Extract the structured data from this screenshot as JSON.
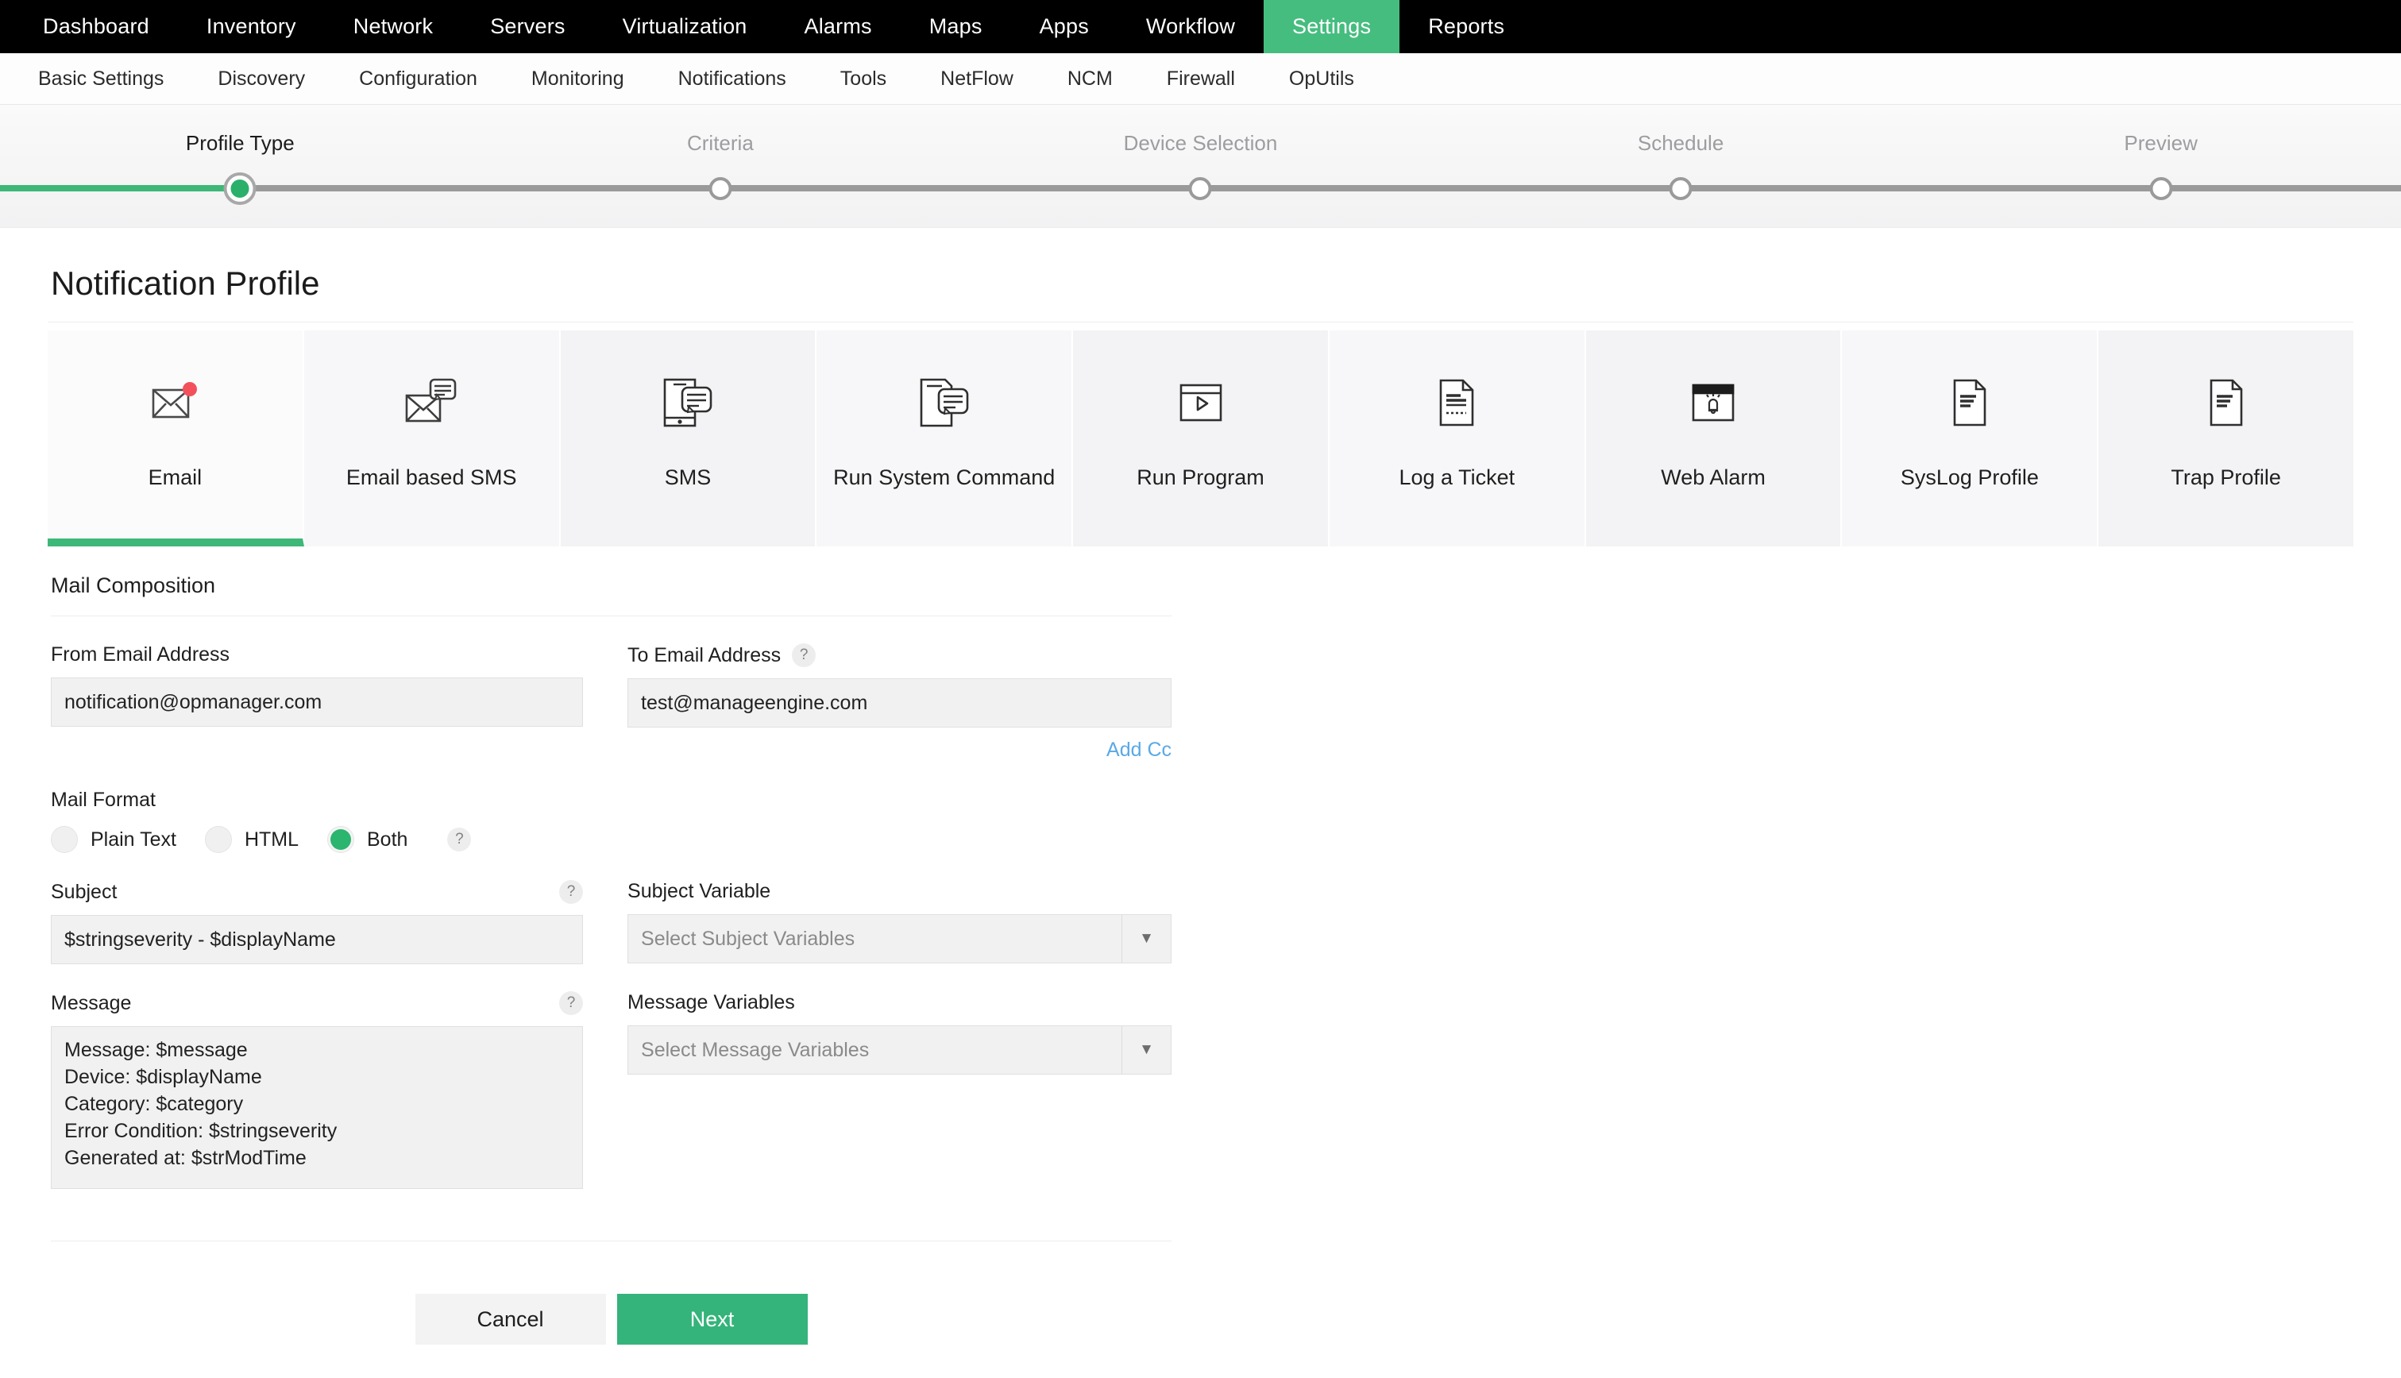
{
  "topnav": {
    "items": [
      {
        "label": "Dashboard",
        "active": false
      },
      {
        "label": "Inventory",
        "active": false
      },
      {
        "label": "Network",
        "active": false
      },
      {
        "label": "Servers",
        "active": false
      },
      {
        "label": "Virtualization",
        "active": false
      },
      {
        "label": "Alarms",
        "active": false
      },
      {
        "label": "Maps",
        "active": false
      },
      {
        "label": "Apps",
        "active": false
      },
      {
        "label": "Workflow",
        "active": false
      },
      {
        "label": "Settings",
        "active": true
      },
      {
        "label": "Reports",
        "active": false
      }
    ],
    "active_color": "#45bd7f"
  },
  "subnav": {
    "items": [
      {
        "label": "Basic Settings"
      },
      {
        "label": "Discovery"
      },
      {
        "label": "Configuration"
      },
      {
        "label": "Monitoring"
      },
      {
        "label": "Notifications"
      },
      {
        "label": "Tools"
      },
      {
        "label": "NetFlow"
      },
      {
        "label": "NCM"
      },
      {
        "label": "Firewall"
      },
      {
        "label": "OpUtils"
      }
    ]
  },
  "wizard": {
    "steps": [
      {
        "label": "Profile Type",
        "state": "active"
      },
      {
        "label": "Criteria",
        "state": "pending"
      },
      {
        "label": "Device Selection",
        "state": "pending"
      },
      {
        "label": "Schedule",
        "state": "pending"
      },
      {
        "label": "Preview",
        "state": "pending"
      }
    ],
    "progress_color": "#3eb878",
    "track_color": "#9a9a9a"
  },
  "page": {
    "title": "Notification Profile"
  },
  "profile_types": [
    {
      "label": "Email",
      "icon": "envelope-alert-icon",
      "selected": true
    },
    {
      "label": "Email based SMS",
      "icon": "envelope-chat-icon",
      "selected": false
    },
    {
      "label": "SMS",
      "icon": "phone-chat-icon",
      "selected": false
    },
    {
      "label": "Run System Command",
      "icon": "document-chat-icon",
      "selected": false
    },
    {
      "label": "Run Program",
      "icon": "window-play-icon",
      "selected": false
    },
    {
      "label": "Log a Ticket",
      "icon": "ticket-document-icon",
      "selected": false
    },
    {
      "label": "Web Alarm",
      "icon": "browser-bell-icon",
      "selected": false
    },
    {
      "label": "SysLog Profile",
      "icon": "syslog-document-icon",
      "selected": false
    },
    {
      "label": "Trap Profile",
      "icon": "trap-document-icon",
      "selected": false
    }
  ],
  "form": {
    "section_title": "Mail Composition",
    "from_email": {
      "label": "From Email Address",
      "value": "notification@opmanager.com",
      "placeholder": ""
    },
    "to_email": {
      "label": "To Email Address",
      "value": "test@manageengine.com",
      "placeholder": "",
      "help": "?"
    },
    "add_cc": "Add Cc",
    "mail_format": {
      "label": "Mail Format",
      "help": "?",
      "options": [
        {
          "label": "Plain Text",
          "checked": false
        },
        {
          "label": "HTML",
          "checked": false
        },
        {
          "label": "Both",
          "checked": true
        }
      ],
      "selected_color": "#2bb56e"
    },
    "subject": {
      "label": "Subject",
      "help": "?",
      "value": "$stringseverity - $displayName"
    },
    "subject_variable": {
      "label": "Subject Variable",
      "placeholder": "Select Subject Variables"
    },
    "message": {
      "label": "Message",
      "help": "?",
      "value": "Message: $message\nDevice: $displayName\nCategory: $category\nError Condition: $stringseverity\nGenerated at: $strModTime"
    },
    "message_variable": {
      "label": "Message Variables",
      "placeholder": "Select Message Variables"
    }
  },
  "buttons": {
    "cancel": "Cancel",
    "next": "Next",
    "next_color": "#34b47a"
  },
  "link_color": "#5aa9e6"
}
